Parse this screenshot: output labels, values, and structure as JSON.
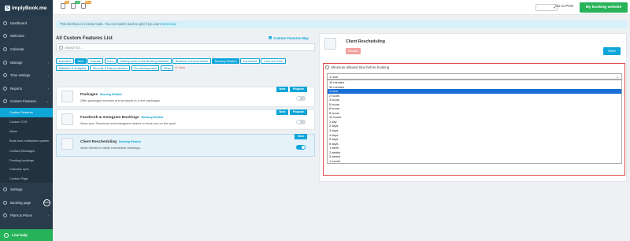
{
  "brand": {
    "badge": "S",
    "name": "implyBook.me"
  },
  "topbar": {
    "pill_a": "11",
    "pill_b": "GO",
    "pill_c": "99+",
    "go_to_pos": "Go to POS",
    "my_booking_website": "My booking website"
  },
  "sidebar": {
    "items_top": [
      {
        "label": "Dashboard"
      },
      {
        "label": "Welcome"
      },
      {
        "label": "Calendar"
      },
      {
        "label": "Manage"
      },
      {
        "label": "Time settings"
      },
      {
        "label": "Reports"
      },
      {
        "label": "Custom Features"
      }
    ],
    "sub_items": [
      {
        "label": "Custom Features"
      },
      {
        "label": "Custom CSS"
      },
      {
        "label": "News"
      },
      {
        "label": "Book Icon notification system"
      },
      {
        "label": "Contact Messages"
      },
      {
        "label": "Pending bookings"
      },
      {
        "label": "Calendar sync"
      },
      {
        "label": "Custom Page"
      }
    ],
    "items_bottom": [
      {
        "label": "Settings"
      },
      {
        "label": "Booking page",
        "badge": "53%"
      },
      {
        "label": "Plans & Prices"
      }
    ],
    "live_help": "Live help"
  },
  "beta": {
    "text": "This interface is in beta mode. You can switch back to grid if you want ",
    "link": "Grid view"
  },
  "list": {
    "title": "All Custom Features List",
    "map_link": "Custom Features Map",
    "search_placeholder": "Search for...",
    "tags": [
      {
        "label": "Activated",
        "on": false
      },
      {
        "label": "New",
        "on": true
      },
      {
        "label": "Popular",
        "on": false
      },
      {
        "label": "Free",
        "on": false
      },
      {
        "label": "Adding more to the Booking Website",
        "on": false
      },
      {
        "label": "Business enhancements",
        "on": false
      },
      {
        "label": "Booking Related",
        "on": true
      },
      {
        "label": "Functional",
        "on": false
      },
      {
        "label": "Look and Feel",
        "on": false
      },
      {
        "label": "Statistics & Analytics",
        "on": false
      },
      {
        "label": "Security & Data protection",
        "on": false
      },
      {
        "label": "For development",
        "on": false
      },
      {
        "label": "Other",
        "on": false
      }
    ],
    "clear": "Clear",
    "cards": [
      {
        "title": "Packages",
        "category": "Booking Related",
        "desc": "Offer packaged services and products in a one packages",
        "ribbon_new": "New",
        "ribbon_popular": "Popular",
        "enabled": false
      },
      {
        "title": "Facebook & Instagram Bookings",
        "category": "Booking Related",
        "desc": "Allow your Facebook and Instagram visitors to book you on the spot!",
        "ribbon_new": "New",
        "ribbon_popular": "Popular",
        "enabled": false
      },
      {
        "title": "Client Rescheduling",
        "category": "Booking Related",
        "desc": "Allow clients to easily reschedule bookings.",
        "ribbon_new": "New",
        "enabled": true
      }
    ]
  },
  "detail": {
    "title": "Client Rescheduling",
    "disable": "Disable",
    "save": "Save",
    "setting_label": "Minimum allowed time before booking",
    "selected_value": "1 hour",
    "options": [
      "15 minutes",
      "30 minutes",
      "1 hour",
      "2 hours",
      "3 hours",
      "5 hours",
      "6 hours",
      "8 hours",
      "12 hours",
      "1 day",
      "2 days",
      "3 days",
      "4 days",
      "5 days",
      "6 days",
      "1 week",
      "2 weeks",
      "3 weeks",
      "1 month"
    ],
    "selected_index": 2
  },
  "colors": {
    "accent": "#0ea5d8",
    "sidebar": "#2a3c4c",
    "green": "#27b35a",
    "highlight": "#e04848"
  }
}
